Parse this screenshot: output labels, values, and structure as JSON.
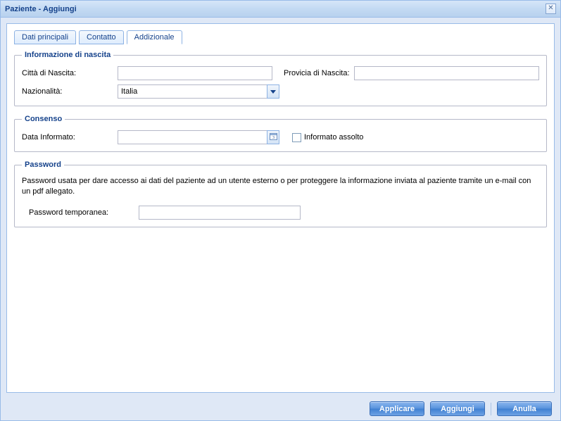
{
  "window": {
    "title": "Paziente - Aggiungi"
  },
  "tabs": {
    "main": "Dati principali",
    "contact": "Contatto",
    "additional": "Addizionale"
  },
  "birth": {
    "legend": "Informazione di nascita",
    "city_label": "Città di Nascita:",
    "city_value": "",
    "province_label": "Provicia di Nascita:",
    "province_value": "",
    "nationality_label": "Nazionalità:",
    "nationality_value": "Italia"
  },
  "consent": {
    "legend": "Consenso",
    "date_label": "Data Informato:",
    "date_value": "",
    "check_label": "Informato assolto"
  },
  "password": {
    "legend": "Password",
    "description": "Password usata per dare accesso ai dati del paziente ad un utente esterno o per proteggere la informazione inviata al paziente tramite un e-mail con un pdf allegato.",
    "temp_label": "Password temporanea:",
    "temp_value": ""
  },
  "buttons": {
    "apply": "Applicare",
    "add": "Aggiungi",
    "cancel": "Anulla"
  }
}
